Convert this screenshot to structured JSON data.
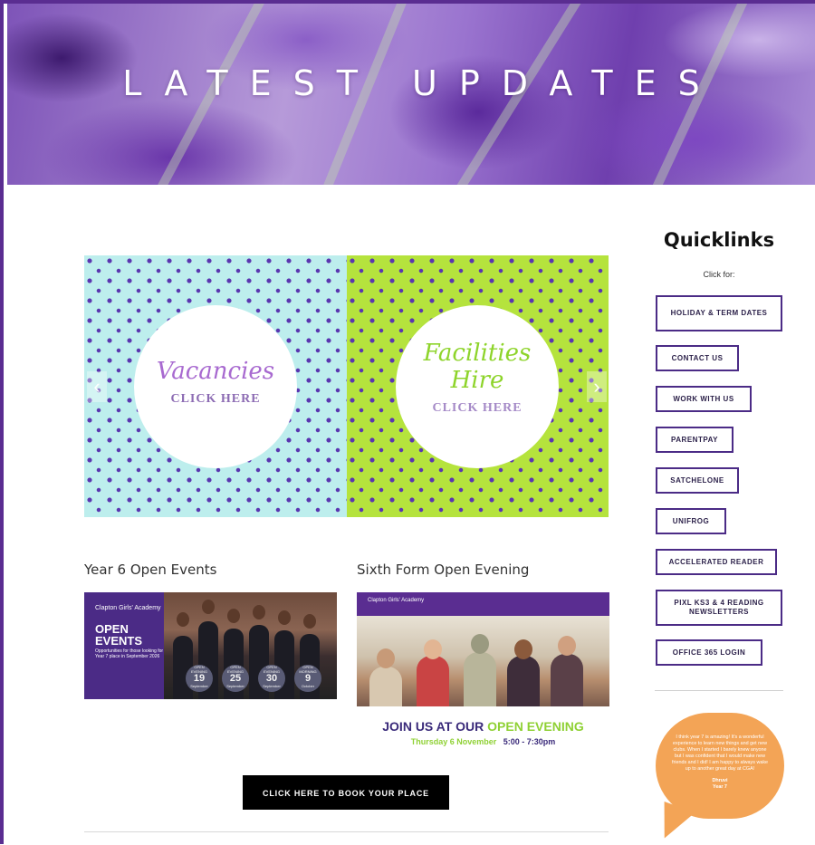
{
  "colors": {
    "brand_purple": "#5a2d91",
    "lime": "#b5e33d",
    "aqua": "#bdeeed",
    "orange": "#f3a456",
    "black": "#000000"
  },
  "hero": {
    "title": "LATEST UPDATES"
  },
  "slider": {
    "slides": [
      {
        "script_text": "Vacancies",
        "cta": "CLICK HERE"
      },
      {
        "script_text": "Facilities Hire",
        "cta": "CLICK HERE"
      }
    ],
    "prev_icon": "chevron-left-icon",
    "next_icon": "chevron-right-icon",
    "prev_glyph": "‹",
    "next_glyph": "›"
  },
  "news": [
    {
      "title": "Year 6 Open Events",
      "image": {
        "logo_text": "Clapton Girls' Academy",
        "heading_line1": "OPEN",
        "heading_line2": "EVENTS",
        "subtext": "Opportunities for those looking for a Year 7 place in September 2026",
        "dates": [
          {
            "label": "OPEN EVENING",
            "day": "19",
            "month": "September"
          },
          {
            "label": "OPEN EVENING",
            "day": "25",
            "month": "September"
          },
          {
            "label": "OPEN EVENING",
            "day": "30",
            "month": "September"
          },
          {
            "label": "OPEN MORNING",
            "day": "9",
            "month": "October"
          }
        ]
      }
    },
    {
      "title": "Sixth Form Open Evening",
      "image": {
        "logo_text": "Clapton Girls' Academy",
        "headline_part1": "JOIN US AT OUR",
        "headline_part2": "OPEN EVENING",
        "date_text": "Thursday 6 November",
        "time_text": "5:00 - 7:30pm"
      }
    }
  ],
  "book_button": "CLICK HERE TO BOOK YOUR PLACE",
  "quicklinks": {
    "title": "Quicklinks",
    "subtitle": "Click for:",
    "items": [
      "HOLIDAY & TERM DATES",
      "CONTACT US",
      "WORK WITH US",
      "PARENTPAY",
      "SATCHELONE",
      "UNIFROG",
      "ACCELERATED READER",
      "PIXL KS3 & 4 READING NEWSLETTERS",
      "OFFICE 365 LOGIN"
    ]
  },
  "testimonial": {
    "quote": "I think year 7 is amazing! It's a wonderful experience to learn new things and get new clubs. When I started I barely knew anyone but I was confident that I would make new friends and I did! I am happy to always wake up to another great day at CGA!",
    "author": "Dhruvi",
    "year": "Year 7"
  }
}
